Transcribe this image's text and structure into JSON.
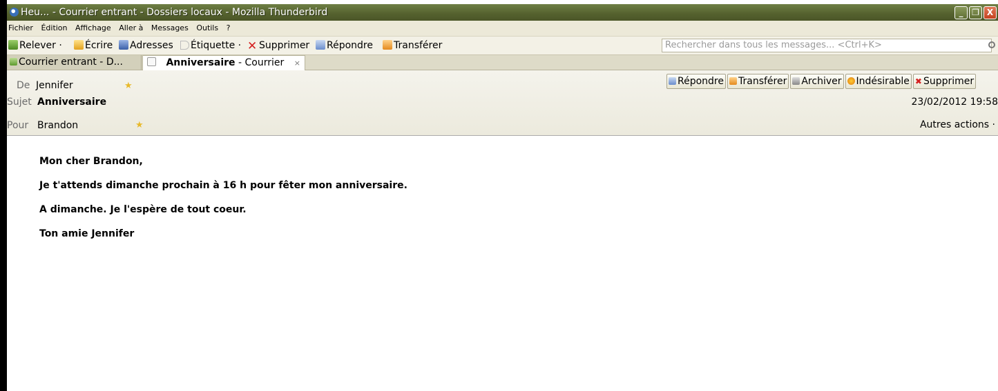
{
  "window": {
    "title": "Heu... - Courrier entrant - Dossiers locaux - Mozilla Thunderbird",
    "minimize": "_",
    "maximize": "❐",
    "close": "X"
  },
  "menu": [
    "Fichier",
    "Édition",
    "Affichage",
    "Aller à",
    "Messages",
    "Outils",
    "?"
  ],
  "toolbar": {
    "relever": "Relever",
    "relever_arrow": "·",
    "ecrire": "Écrire",
    "adresses": "Adresses",
    "etiquette": "Étiquette",
    "etiquette_arrow": "·",
    "supprimer": "Supprimer",
    "repondre": "Répondre",
    "transferer": "Transférer",
    "search_placeholder": "Rechercher dans tous les messages... <Ctrl+K>"
  },
  "tabs": {
    "inbox": "Courrier entrant - D...",
    "message_bold": "Anniversaire",
    "message_rest": "- Courrier",
    "close": "×"
  },
  "header": {
    "from_label": "De",
    "from_value": "Jennifer",
    "subject_label": "Sujet",
    "subject_value": "Anniversaire",
    "to_label": "Pour",
    "to_value": "Brandon",
    "date": "23/02/2012 19:58",
    "more_actions": "Autres actions ·",
    "buttons": {
      "reply": "Répondre",
      "forward": "Transférer",
      "archive": "Archiver",
      "junk": "Indésirable",
      "delete": "Supprimer"
    }
  },
  "message": {
    "lines": [
      "Mon cher Brandon,",
      "Je t'attends dimanche prochain à 16 h pour fêter mon anniversaire.",
      "A dimanche. Je l'espère de tout coeur.",
      "Ton amie Jennifer"
    ]
  },
  "colors": {
    "titlebar": "#56632f",
    "star": "#e8b92a",
    "delete_red": "#d42020"
  }
}
